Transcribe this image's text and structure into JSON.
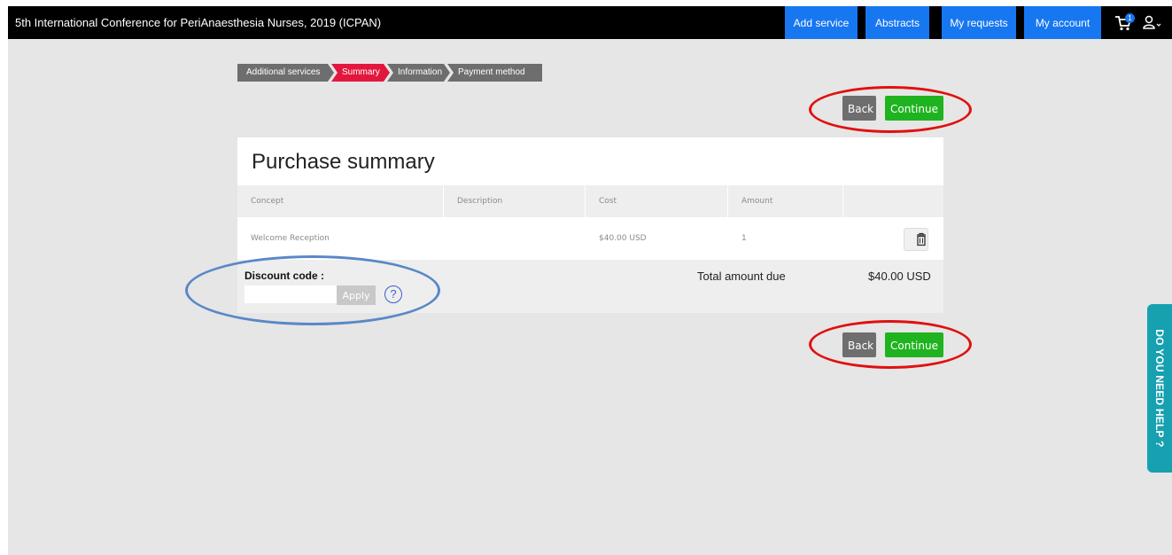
{
  "header": {
    "title": "5th International Conference for PeriAnaesthesia Nurses, 2019 (ICPAN)",
    "nav": [
      "Add service",
      "Abstracts",
      "My requests",
      "My account"
    ],
    "cart_count": "1",
    "icons": [
      "cart-icon",
      "user-icon",
      "chevron-down-icon"
    ]
  },
  "steps": [
    {
      "label": "Additional services",
      "active": false
    },
    {
      "label": "Summary",
      "active": true
    },
    {
      "label": "Information",
      "active": false
    },
    {
      "label": "Payment method",
      "active": false
    }
  ],
  "actions": {
    "back": "Back",
    "continue": "Continue"
  },
  "summary": {
    "title": "Purchase summary",
    "columns": [
      "Concept",
      "Description",
      "Cost",
      "Amount"
    ],
    "rows": [
      {
        "concept": "Welcome Reception",
        "description": "",
        "cost": "$40.00 USD",
        "amount": "1"
      }
    ],
    "discount_label": "Discount code :",
    "discount_value": "",
    "apply_label": "Apply",
    "help_symbol": "?",
    "total_label": "Total amount due",
    "total_value": "$40.00 USD"
  },
  "help_tab": "DO YOU NEED HELP ?",
  "colors": {
    "nav_blue": "#1777f1",
    "step_active": "#e2173d",
    "continue_green": "#1fb31f",
    "annotation_red": "#e01010",
    "annotation_blue": "#5a87c8",
    "help_tab": "#17a0b0"
  }
}
